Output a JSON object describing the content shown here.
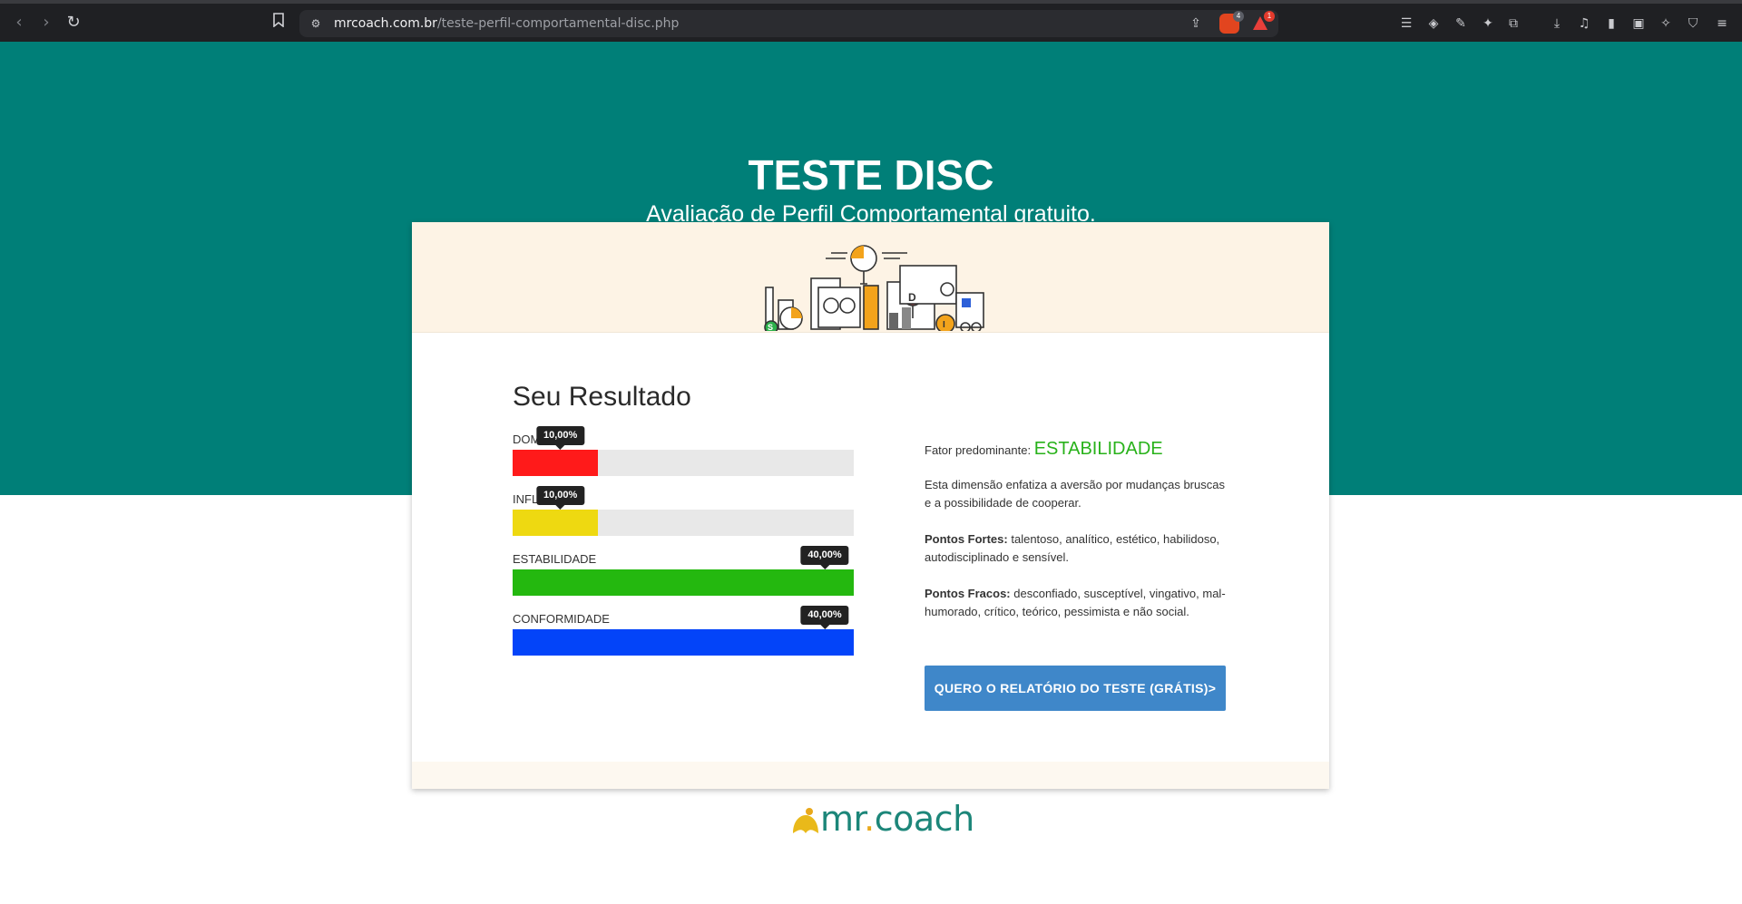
{
  "browser": {
    "url_host": "mrcoach.com.br",
    "url_path": "/teste-perfil-comportamental-disc.php",
    "brave_shield_count": "4",
    "alert_count": "1"
  },
  "hero": {
    "title": "TESTE DISC",
    "subtitle": "Avaliação de Perfil Comportamental gratuito."
  },
  "result": {
    "title": "Seu Resultado",
    "bars": [
      {
        "label": "DOMI",
        "value_text": "10,00%",
        "value": 0.25,
        "color": "#ff1a1a"
      },
      {
        "label": "INFLU",
        "value_text": "10,00%",
        "value": 0.25,
        "color": "#eed911"
      },
      {
        "label": "ESTABILIDADE",
        "value_text": "40,00%",
        "value": 1.0,
        "color": "#24b80f"
      },
      {
        "label": "CONFORMIDADE",
        "value_text": "40,00%",
        "value": 1.0,
        "color": "#0344f9"
      }
    ]
  },
  "analysis": {
    "factor_label": "Fator predominante:",
    "factor_value": "ESTABILIDADE",
    "description": "Esta dimensão enfatiza a aversão por mudanças bruscas e a possibilidade de cooperar.",
    "strengths_label": "Pontos Fortes:",
    "strengths": "talentoso, analítico, estético, habilidoso, autodisciplinado e sensível.",
    "weaknesses_label": "Pontos Fracos:",
    "weaknesses": "desconfiado, susceptível, vingativo, mal-humorado, crítico, teórico, pessimista e não social.",
    "cta_label": "QUERO O RELATÓRIO DO TESTE (GRÁTIS)>"
  },
  "footer": {
    "logo_text_a": "mr",
    "logo_text_dot": ".",
    "logo_text_b": "coach"
  },
  "colors": {
    "hero_bg": "#007f78",
    "accent_green": "#28b21a",
    "cta_blue": "#3f87c9"
  }
}
